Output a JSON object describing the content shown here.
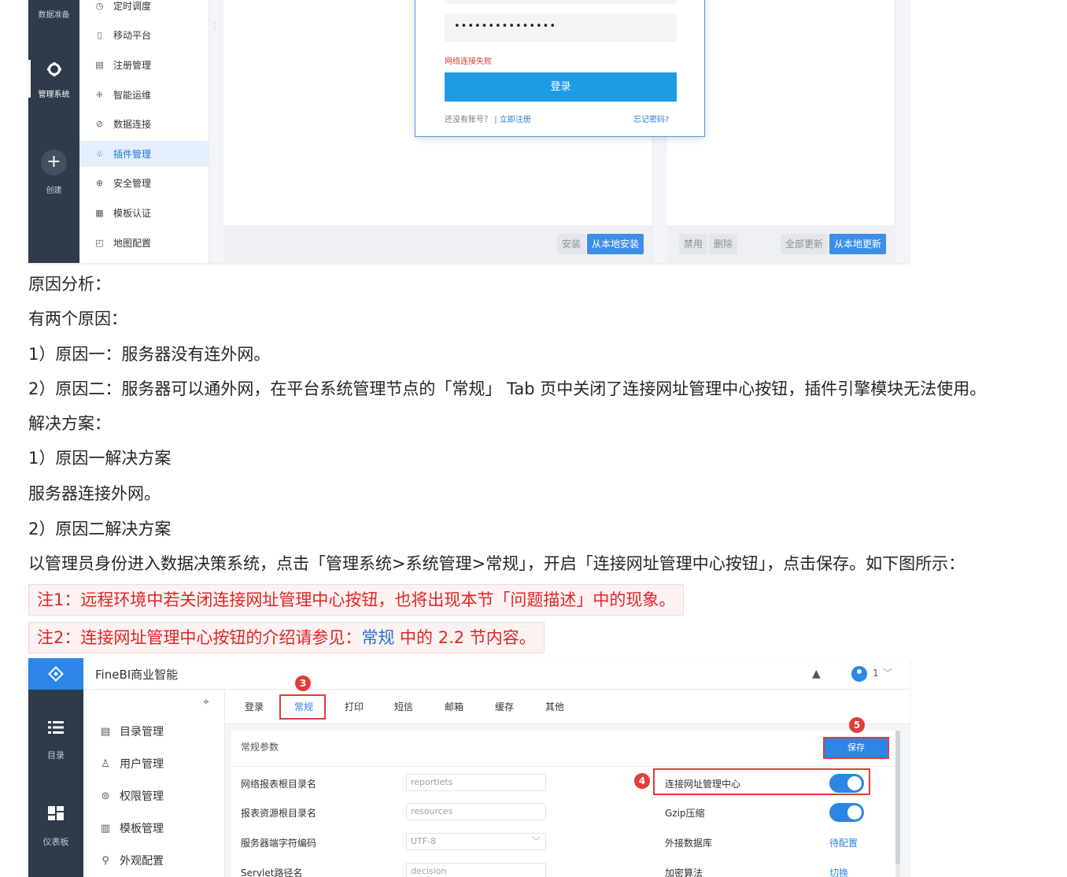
{
  "shot1": {
    "rail": {
      "data_prep": "数据准备",
      "admin": "管理系统",
      "create": "创建"
    },
    "menu": [
      {
        "label": "定时调度",
        "icon": "clock-icon"
      },
      {
        "label": "移动平台",
        "icon": "mobile-icon"
      },
      {
        "label": "注册管理",
        "icon": "register-icon"
      },
      {
        "label": "智能运维",
        "icon": "ops-icon"
      },
      {
        "label": "数据连接",
        "icon": "link-icon"
      },
      {
        "label": "插件管理",
        "icon": "plugin-icon",
        "active": true
      },
      {
        "label": "安全管理",
        "icon": "shield-icon"
      },
      {
        "label": "模板认证",
        "icon": "template-icon"
      },
      {
        "label": "地图配置",
        "icon": "map-icon"
      }
    ],
    "login": {
      "password": "•••••••••••••••",
      "error": "网络连接失败",
      "button": "登录",
      "no_account": "还没有账号？",
      "divider": "|",
      "register": "立即注册",
      "forgot": "忘记密码?"
    },
    "left_footer": {
      "install": "安装",
      "install_local": "从本地安装"
    },
    "right_footer": {
      "disable": "禁用",
      "delete": "删除",
      "update_all": "全部更新",
      "update_local": "从本地更新"
    }
  },
  "article": {
    "cause_heading": "原因分析：",
    "cause_intro": "有两个原因：",
    "cause1": "1）原因一：服务器没有连外网。",
    "cause2": "2）原因二：服务器可以通外网，在平台系统管理节点的「常规」 Tab 页中关闭了连接网址管理中心按钮，插件引擎模块无法使用。",
    "solution_heading": "解决方案：",
    "solution1_title": "1）原因一解决方案",
    "solution1_text": "服务器连接外网。",
    "solution2_title": "2）原因二解决方案",
    "solution2_text": "以管理员身份进入数据决策系统，点击「管理系统>系统管理>常规」，开启「连接网址管理中心按钮」，点击保存。如下图所示：",
    "note1": "注1：远程环境中若关闭连接网址管理中心按钮，也将出现本节「问题描述」中的现象。",
    "note2_prefix": "注2：连接网址管理中心按钮的介绍请参见：",
    "note2_link": "常规",
    "note2_suffix": " 中的 2.2 节内容。"
  },
  "shot2": {
    "app_title": "FineBI商业智能",
    "user": "1",
    "rail": {
      "catalog": "目录",
      "dashboard": "仪表板"
    },
    "menu": [
      {
        "label": "目录管理",
        "icon": "catalog-icon"
      },
      {
        "label": "用户管理",
        "icon": "user-icon"
      },
      {
        "label": "权限管理",
        "icon": "lock-icon"
      },
      {
        "label": "模板管理",
        "icon": "template-icon"
      },
      {
        "label": "外观配置",
        "icon": "appearance-icon"
      }
    ],
    "tabs": [
      "登录",
      "常规",
      "打印",
      "短信",
      "邮箱",
      "缓存",
      "其他"
    ],
    "section_title": "常规参数",
    "save": "保存",
    "fields": [
      {
        "label": "网络报表根目录名",
        "value": "reportlets"
      },
      {
        "label": "报表资源根目录名",
        "value": "resources"
      },
      {
        "label": "服务器端字符编码",
        "value": "UTF-8"
      },
      {
        "label": "Servlet路径名",
        "value": "decision"
      }
    ],
    "right_settings": [
      {
        "label": "连接网址管理中心",
        "type": "toggle",
        "on": true
      },
      {
        "label": "Gzip压缩",
        "type": "toggle",
        "on": true
      },
      {
        "label": "外接数据库",
        "type": "link",
        "value": "待配置"
      },
      {
        "label": "加密算法",
        "type": "link",
        "value": "切换"
      }
    ],
    "badges": [
      "3",
      "4",
      "5"
    ]
  }
}
